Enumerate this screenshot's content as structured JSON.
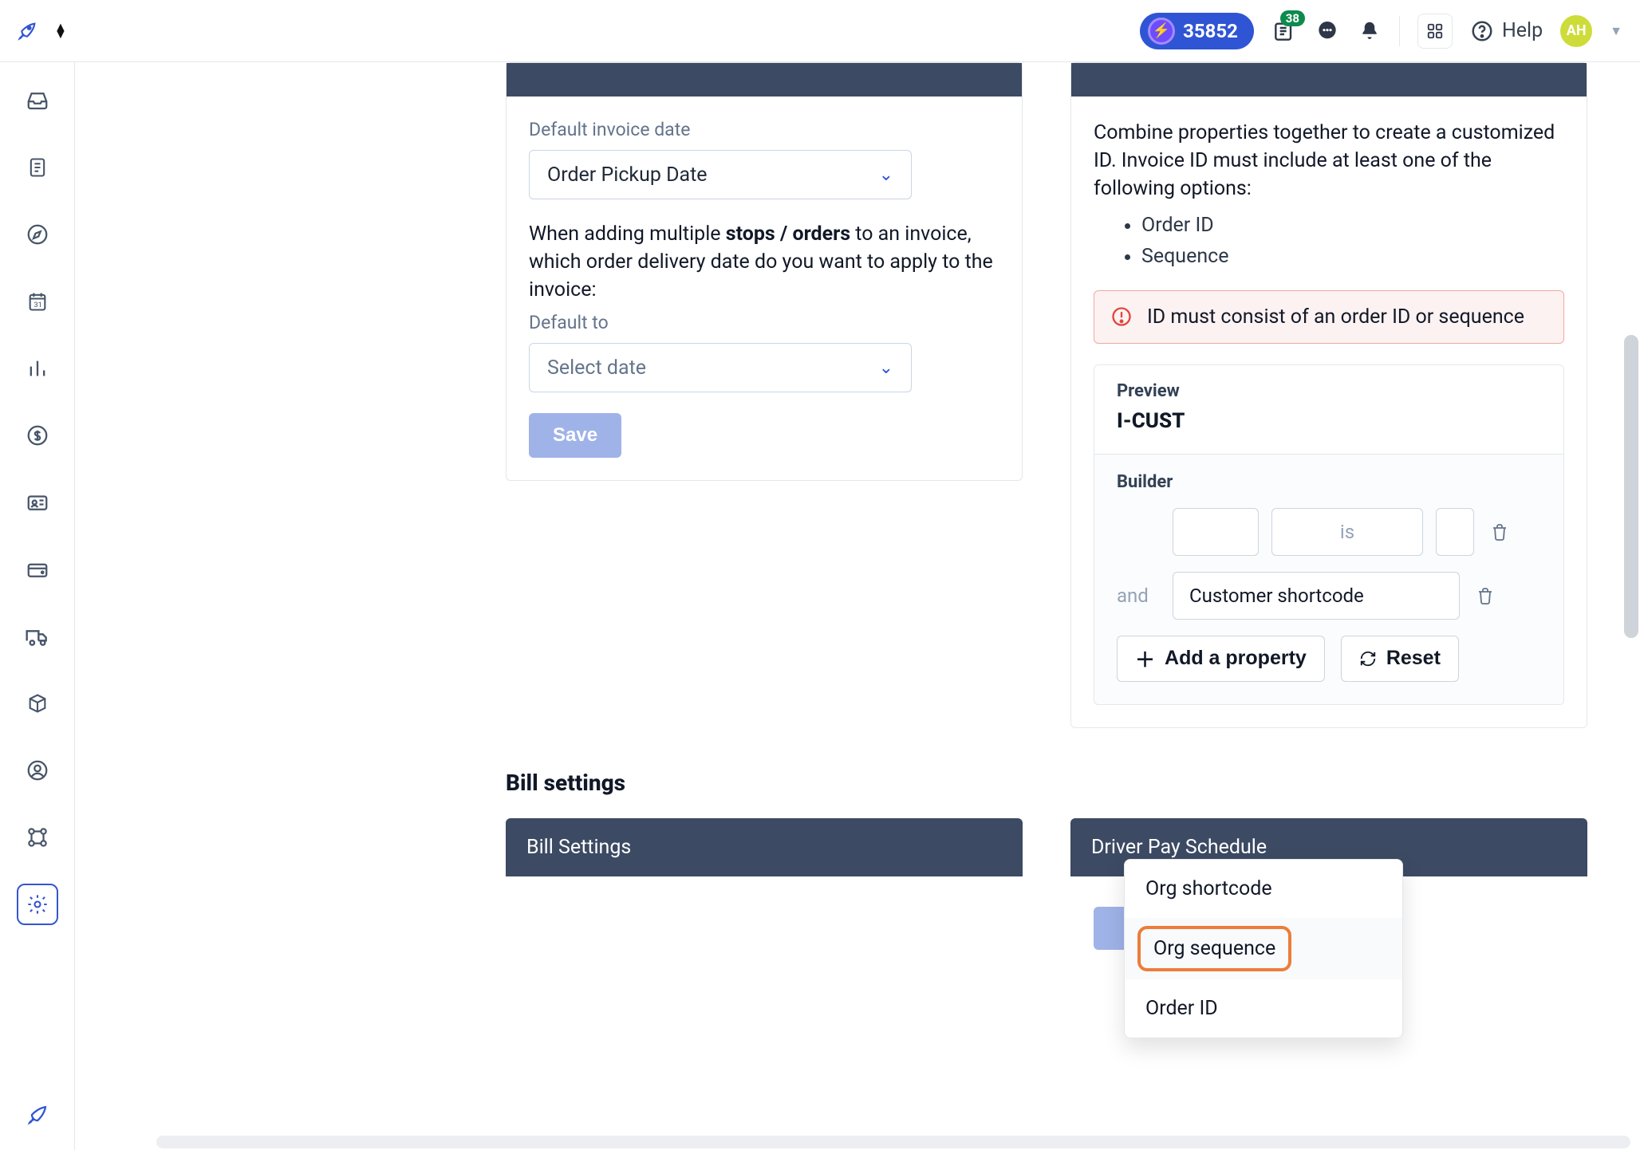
{
  "topbar": {
    "points": "35852",
    "news_badge": "38",
    "help_label": "Help",
    "avatar_initials": "AH"
  },
  "sidebar": {
    "items": [
      "inbox",
      "document",
      "compass",
      "calendar",
      "analytics",
      "dollar",
      "id-card",
      "wallet",
      "truck",
      "package",
      "user",
      "sitemap",
      "settings"
    ],
    "active_index": 12
  },
  "date_settings": {
    "label_default_invoice_date": "Default invoice date",
    "select_default_invoice_date": "Order Pickup Date",
    "multi_text_pre": "When adding multiple ",
    "multi_text_bold": "stops / orders",
    "multi_text_post": " to an invoice, which order delivery date do you want to apply to the invoice:",
    "label_default_to": "Default to",
    "select_default_to_placeholder": "Select date",
    "save_label": "Save"
  },
  "invoice_id": {
    "desc": "Combine properties together to create a customized ID. Invoice ID must include at least one of the following options:",
    "desc_list": [
      "Order ID",
      "Sequence"
    ],
    "error_text": "ID must consist of an order ID or sequence",
    "preview_label": "Preview",
    "preview_value": "I-CUST",
    "builder_label": "Builder",
    "row1_mid": "is",
    "row2_and": "and",
    "row2_value": "Customer shortcode",
    "add_property_label": "Add a property",
    "reset_label": "Reset",
    "dropdown": {
      "options": [
        "Org shortcode",
        "Org sequence",
        "Order ID"
      ],
      "highlighted_index": 1
    }
  },
  "bill": {
    "section_title": "Bill settings",
    "card_left_title": "Bill Settings",
    "card_right_title": "Driver Pay Schedule"
  }
}
